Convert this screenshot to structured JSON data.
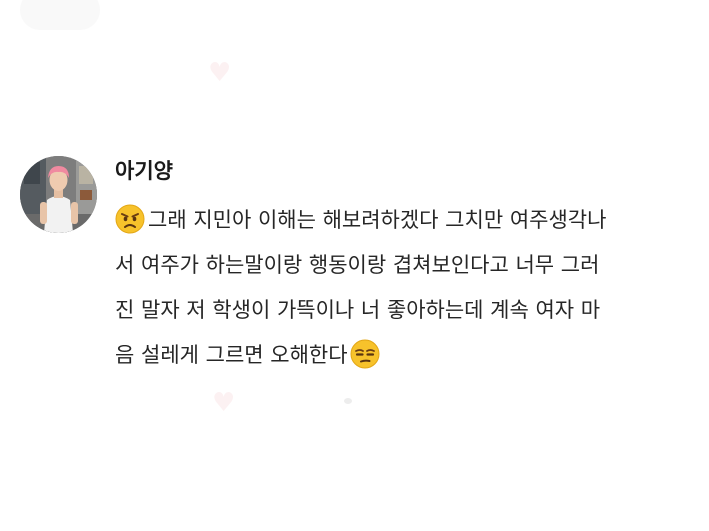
{
  "comment": {
    "username": "아기양",
    "lines": [
      "그래 지민아 이해는 해보려하겠다 그치만 여주생각나",
      "서 여주가 하는말이랑 행동이랑 겹쳐보인다고 너무 그러",
      "진 말자 저 학생이 가뜩이나 너 좋아하는데 계속 여자 마",
      "음 설레게 그르면 오해한다"
    ],
    "emoji_start": "angry-face-emoji",
    "emoji_end": "unamused-face-emoji"
  },
  "colors": {
    "username": "#1a1a1a",
    "text": "#262626",
    "background": "#ffffff",
    "emoji_face": "#f7c22b"
  }
}
